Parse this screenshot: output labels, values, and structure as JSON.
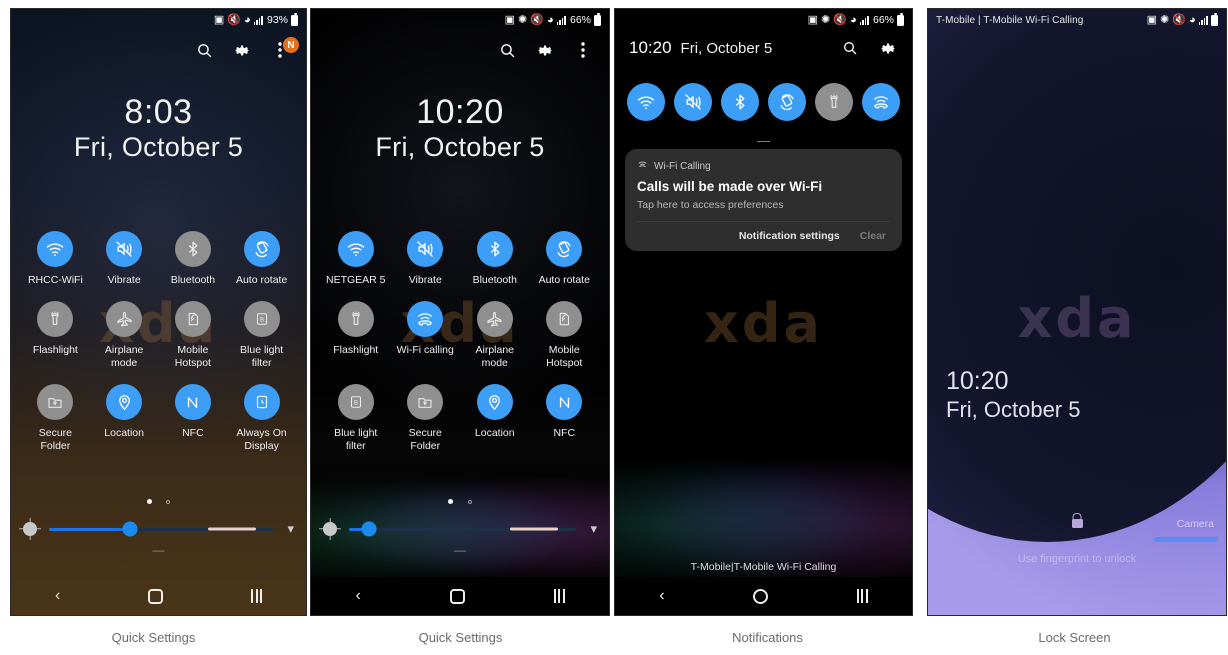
{
  "captions": [
    "Quick Settings",
    "Quick Settings",
    "Notifications",
    "Lock Screen"
  ],
  "colors": {
    "tile_on": "#3d9ef7",
    "tile_off": "#8f8f8f",
    "badge": "#e8701a",
    "slider_fill": "#1a73e8",
    "camera_bar": "#5a8cf0"
  },
  "panel1": {
    "statusbar": {
      "battery": "93%",
      "icons": [
        "nfc-icon",
        "mute-icon",
        "wifi-icon",
        "signal-icon",
        "battery-icon"
      ]
    },
    "header": {
      "search": "search-icon",
      "settings": "gear-icon",
      "overflow": "overflow-menu-icon",
      "badge": "N"
    },
    "clock": {
      "time": "8:03",
      "date": "Fri, October 5"
    },
    "watermark": "xda",
    "tiles": [
      {
        "label": "RHCC-WiFi",
        "icon": "wifi-icon",
        "on": true
      },
      {
        "label": "Vibrate",
        "icon": "vibrate-icon",
        "on": true
      },
      {
        "label": "Bluetooth",
        "icon": "bluetooth-icon",
        "on": false
      },
      {
        "label": "Auto rotate",
        "icon": "auto-rotate-icon",
        "on": true
      },
      {
        "label": "Flashlight",
        "icon": "flashlight-icon",
        "on": false
      },
      {
        "label": "Airplane mode",
        "icon": "airplane-icon",
        "on": false
      },
      {
        "label": "Mobile Hotspot",
        "icon": "hotspot-icon",
        "on": false
      },
      {
        "label": "Blue light filter",
        "icon": "blue-light-icon",
        "on": false
      },
      {
        "label": "Secure Folder",
        "icon": "secure-folder-icon",
        "on": false
      },
      {
        "label": "Location",
        "icon": "location-icon",
        "on": true
      },
      {
        "label": "NFC",
        "icon": "nfc-icon",
        "on": true
      },
      {
        "label": "Always On Display",
        "icon": "always-on-display-icon",
        "on": true
      }
    ],
    "brightness": {
      "value": 36,
      "page": 1,
      "pages": 2
    },
    "nav": [
      "back-button",
      "home-button",
      "recents-button"
    ]
  },
  "panel2": {
    "statusbar": {
      "battery": "66%",
      "icons": [
        "nfc-icon",
        "bluetooth-icon",
        "mute-icon",
        "wifi-icon",
        "signal-icon",
        "battery-icon"
      ]
    },
    "header": {
      "search": "search-icon",
      "settings": "gear-icon",
      "overflow": "overflow-menu-icon"
    },
    "clock": {
      "time": "10:20",
      "date": "Fri, October 5"
    },
    "watermark": "xda",
    "tiles": [
      {
        "label": "NETGEAR 5",
        "icon": "wifi-icon",
        "on": true
      },
      {
        "label": "Vibrate",
        "icon": "vibrate-icon",
        "on": true
      },
      {
        "label": "Bluetooth",
        "icon": "bluetooth-icon",
        "on": true
      },
      {
        "label": "Auto rotate",
        "icon": "auto-rotate-icon",
        "on": true
      },
      {
        "label": "Flashlight",
        "icon": "flashlight-icon",
        "on": false
      },
      {
        "label": "Wi-Fi calling",
        "icon": "wifi-calling-icon",
        "on": true
      },
      {
        "label": "Airplane mode",
        "icon": "airplane-icon",
        "on": false
      },
      {
        "label": "Mobile Hotspot",
        "icon": "hotspot-icon",
        "on": false
      },
      {
        "label": "Blue light filter",
        "icon": "blue-light-icon",
        "on": false
      },
      {
        "label": "Secure Folder",
        "icon": "secure-folder-icon",
        "on": false
      },
      {
        "label": "Location",
        "icon": "location-icon",
        "on": true
      },
      {
        "label": "NFC",
        "icon": "nfc-icon",
        "on": true
      }
    ],
    "brightness": {
      "value": 9,
      "page": 1,
      "pages": 2
    },
    "nav": [
      "back-button",
      "home-button",
      "recents-button"
    ]
  },
  "panel3": {
    "statusbar": {
      "battery": "66%",
      "icons": [
        "nfc-icon",
        "bluetooth-icon",
        "mute-icon",
        "wifi-icon",
        "signal-icon",
        "battery-icon"
      ]
    },
    "header": {
      "time": "10:20",
      "date": "Fri, October 5",
      "search": "search-icon",
      "settings": "gear-icon"
    },
    "tiles": [
      {
        "icon": "wifi-icon",
        "on": true
      },
      {
        "icon": "vibrate-icon",
        "on": true
      },
      {
        "icon": "bluetooth-icon",
        "on": true
      },
      {
        "icon": "auto-rotate-icon",
        "on": true
      },
      {
        "icon": "flashlight-icon",
        "on": false
      },
      {
        "icon": "wifi-calling-icon",
        "on": true
      }
    ],
    "notification": {
      "app": "Wi-Fi Calling",
      "title": "Calls will be made over Wi-Fi",
      "subtitle": "Tap here to access preferences",
      "settings_label": "Notification settings",
      "clear_label": "Clear"
    },
    "watermark": "xda",
    "carrier_footer": "T-Mobile|T-Mobile Wi-Fi Calling",
    "nav": [
      "back-button",
      "home-button",
      "recents-button"
    ]
  },
  "panel4": {
    "statusbar": {
      "carrier": "T-Mobile | T-Mobile Wi-Fi Calling",
      "icons": [
        "nfc-icon",
        "bluetooth-icon",
        "mute-icon",
        "wifi-icon",
        "signal-icon",
        "battery-icon"
      ]
    },
    "watermark": "xda",
    "clock": {
      "time": "10:20",
      "date": "Fri, October 5"
    },
    "lock_hint": "Use fingerprint to unlock",
    "camera_label": "Camera",
    "lock_icon": "padlock-icon"
  }
}
